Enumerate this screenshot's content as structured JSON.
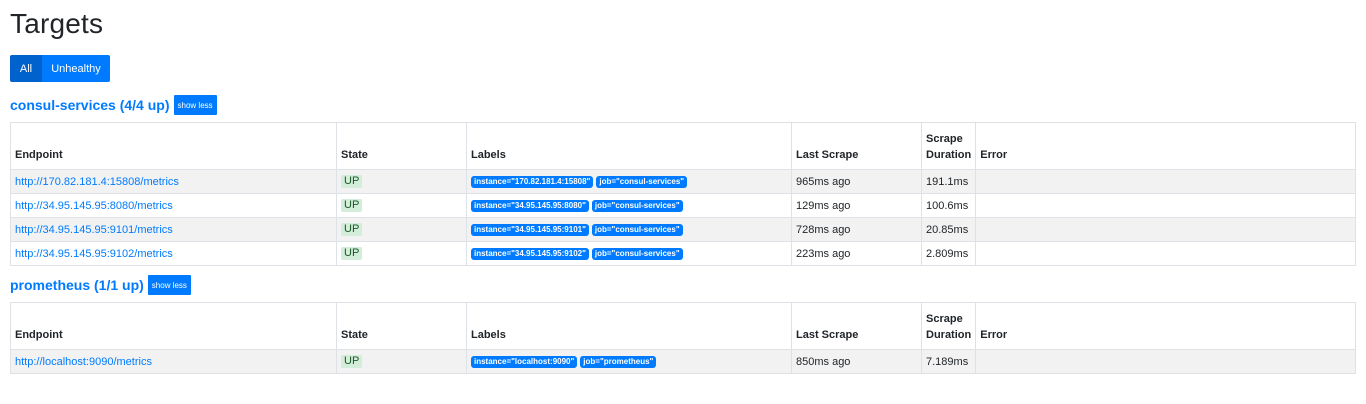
{
  "page": {
    "title": "Targets",
    "filter": {
      "all": "All",
      "unhealthy": "Unhealthy"
    }
  },
  "columns": {
    "endpoint": "Endpoint",
    "state": "State",
    "labels": "Labels",
    "last_scrape": "Last Scrape",
    "scrape_duration_1": "Scrape",
    "scrape_duration_2": "Duration",
    "error": "Error"
  },
  "jobs": [
    {
      "title": "consul-services (4/4 up)",
      "toggle": "show less",
      "targets": [
        {
          "endpoint": "http://170.82.181.4:15808/metrics",
          "state": "UP",
          "labels": [
            "instance=\"170.82.181.4:15808\"",
            "job=\"consul-services\""
          ],
          "last_scrape": "965ms ago",
          "duration": "191.1ms",
          "error": ""
        },
        {
          "endpoint": "http://34.95.145.95:8080/metrics",
          "state": "UP",
          "labels": [
            "instance=\"34.95.145.95:8080\"",
            "job=\"consul-services\""
          ],
          "last_scrape": "129ms ago",
          "duration": "100.6ms",
          "error": ""
        },
        {
          "endpoint": "http://34.95.145.95:9101/metrics",
          "state": "UP",
          "labels": [
            "instance=\"34.95.145.95:9101\"",
            "job=\"consul-services\""
          ],
          "last_scrape": "728ms ago",
          "duration": "20.85ms",
          "error": ""
        },
        {
          "endpoint": "http://34.95.145.95:9102/metrics",
          "state": "UP",
          "labels": [
            "instance=\"34.95.145.95:9102\"",
            "job=\"consul-services\""
          ],
          "last_scrape": "223ms ago",
          "duration": "2.809ms",
          "error": ""
        }
      ]
    },
    {
      "title": "prometheus (1/1 up)",
      "toggle": "show less",
      "targets": [
        {
          "endpoint": "http://localhost:9090/metrics",
          "state": "UP",
          "labels": [
            "instance=\"localhost:9090\"",
            "job=\"prometheus\""
          ],
          "last_scrape": "850ms ago",
          "duration": "7.189ms",
          "error": ""
        }
      ]
    }
  ]
}
